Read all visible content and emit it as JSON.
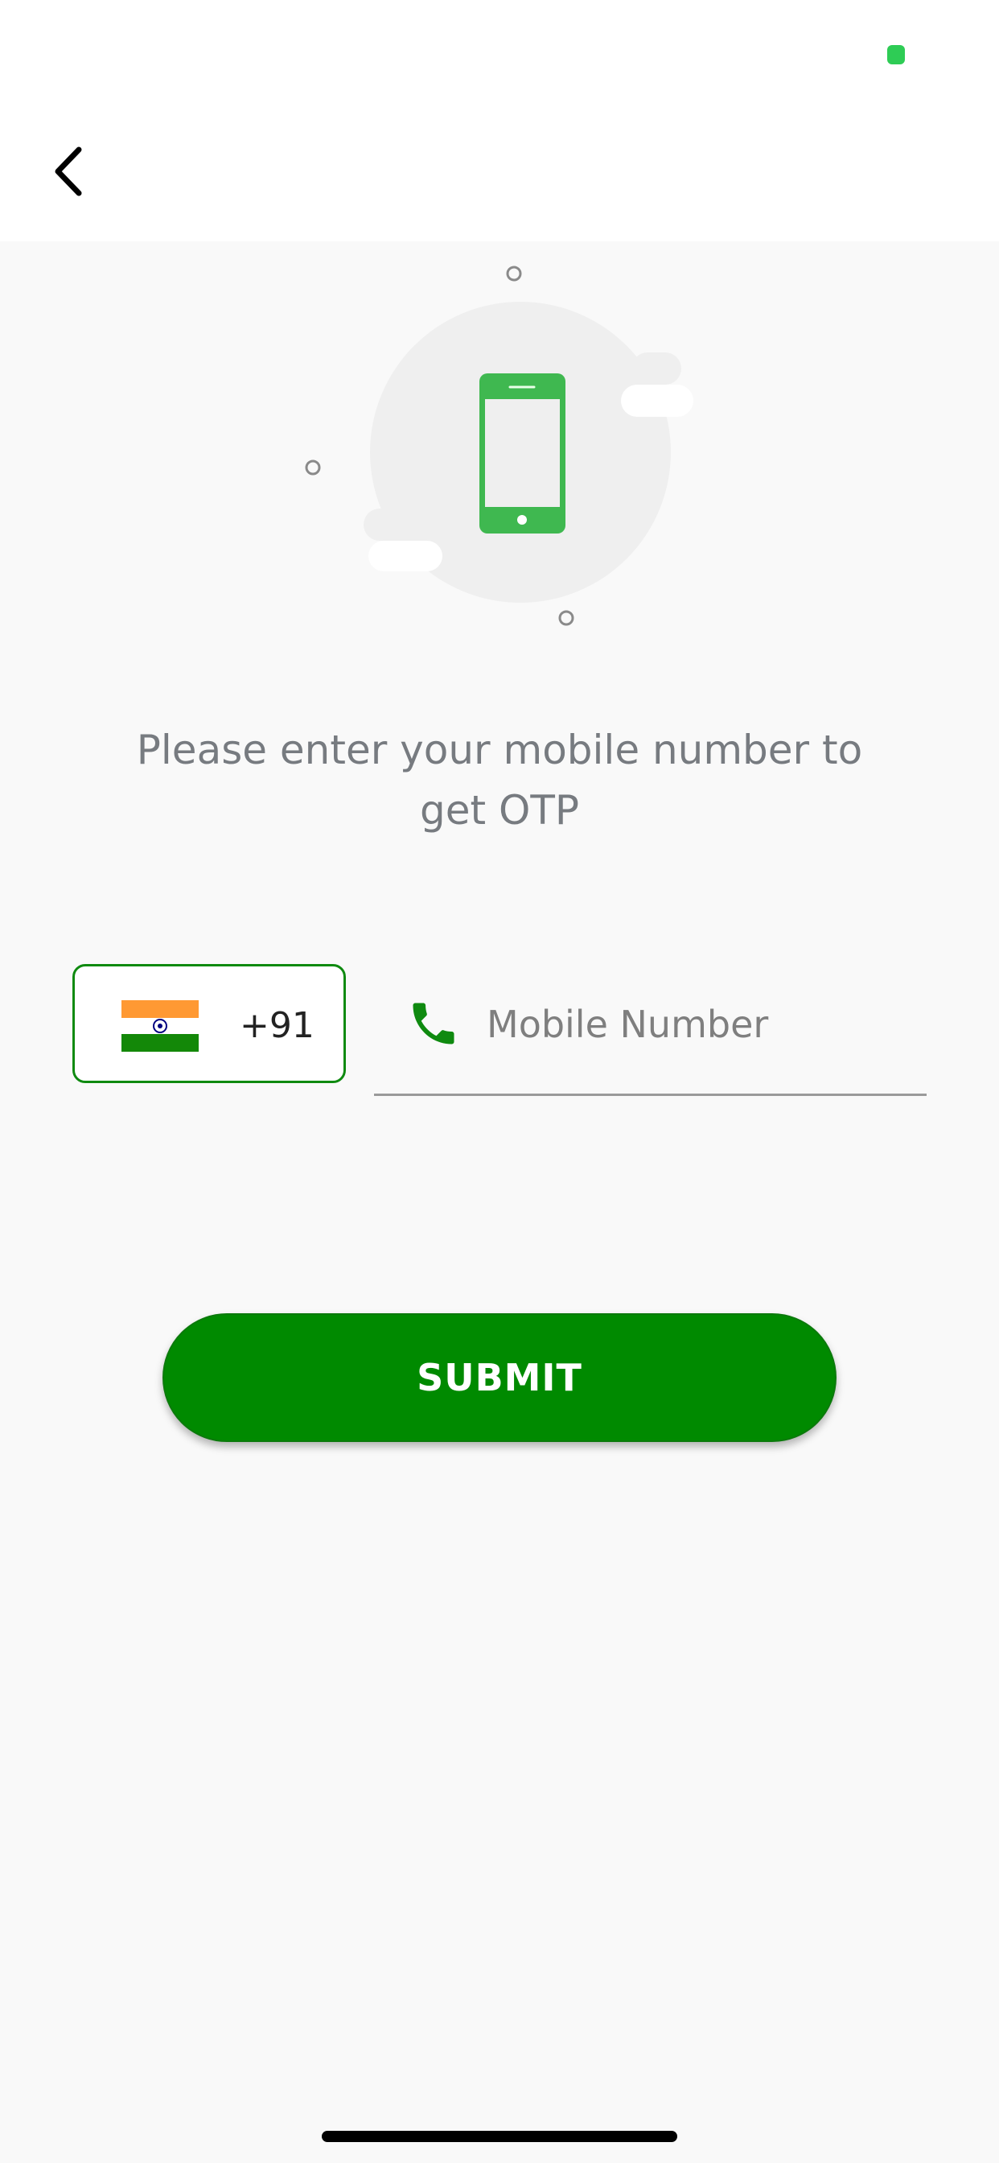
{
  "status_bar": {
    "battery_color": "#2ecc55"
  },
  "nav": {
    "back_icon": "chevron-left-icon"
  },
  "illustration": {
    "icon": "smartphone-icon",
    "accent_color": "#3fb850"
  },
  "prompt": {
    "text": "Please enter your mobile number to get OTP"
  },
  "country": {
    "flag": "india-flag-icon",
    "dial_code": "+91",
    "border_color": "#0f8a10"
  },
  "phone_field": {
    "icon": "phone-icon",
    "value": "",
    "placeholder": "Mobile Number"
  },
  "submit": {
    "label": "SUBMIT",
    "color": "#008a00"
  }
}
